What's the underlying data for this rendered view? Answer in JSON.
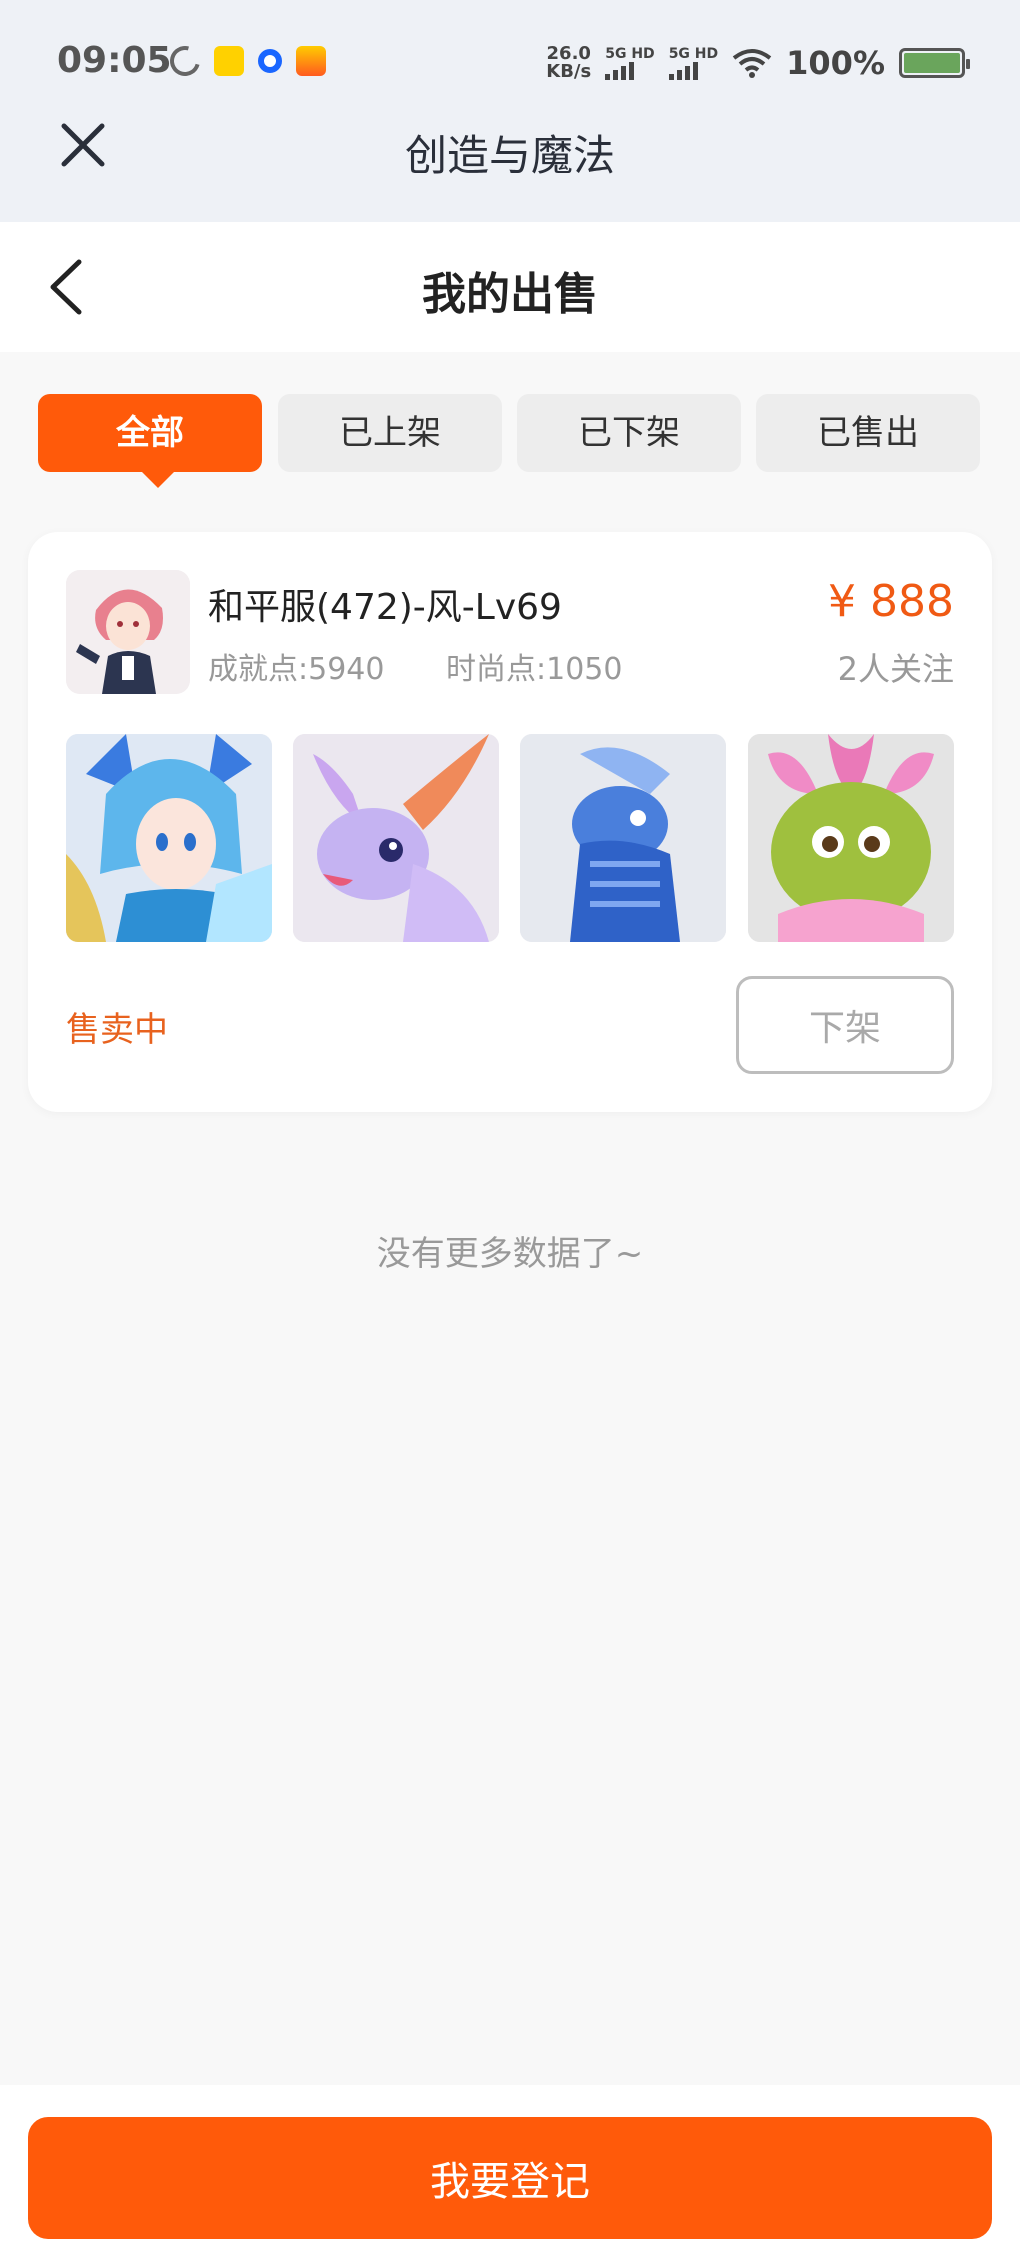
{
  "status_bar": {
    "time": "09:05",
    "net_speed_value": "26.0",
    "net_speed_unit": "KB/s",
    "sim1": "5G HD",
    "sim2": "5G HD",
    "battery": "100%"
  },
  "app": {
    "title": "创造与魔法"
  },
  "page": {
    "title": "我的出售"
  },
  "tabs": [
    {
      "label": "全部",
      "active": true
    },
    {
      "label": "已上架",
      "active": false
    },
    {
      "label": "已下架",
      "active": false
    },
    {
      "label": "已售出",
      "active": false
    }
  ],
  "listing": {
    "title": "和平服(472)-风-Lv69",
    "achievement": "成就点:5940",
    "fashion": "时尚点:1050",
    "price": "¥ 888",
    "followers": "2人关注",
    "thumbnails": [
      "blue-hair-character",
      "purple-dragon-pet",
      "blue-dragon-mount",
      "green-flower-pet"
    ],
    "status": "售卖中",
    "delist_label": "下架"
  },
  "list_footer": "没有更多数据了~",
  "bottom": {
    "register_label": "我要登记"
  },
  "colors": {
    "accent": "#ff5a0a",
    "price": "#f05a14"
  }
}
